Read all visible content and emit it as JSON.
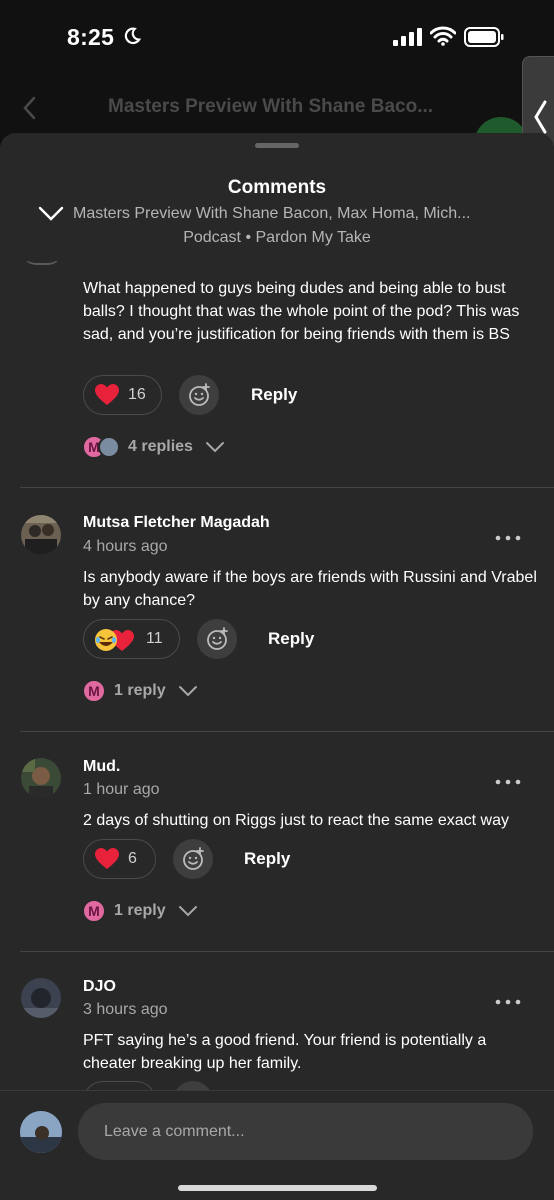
{
  "status_bar": {
    "time": "8:25"
  },
  "background": {
    "title": "Masters Preview With Shane Baco..."
  },
  "sheet": {
    "title": "Comments",
    "episode": "Masters Preview With Shane Bacon, Max Homa, Mich...",
    "podcast": "Podcast • Pardon My Take"
  },
  "comments": [
    {
      "text": "What happened to guys being dudes and being able to bust balls? I thought that was the whole point of the pod? This was sad, and you’re justification for being friends with them is BS",
      "reaction_count": "16",
      "reply_label": "Reply",
      "replies_label": "4 replies",
      "reply_avatar_letter": "M"
    },
    {
      "username": "Mutsa Fletcher Magadah",
      "time": "4 hours ago",
      "text": "Is anybody aware if the boys are friends with Russini and Vrabel by any chance?",
      "reaction_count": "11",
      "reply_label": "Reply",
      "replies_label": "1 reply",
      "reply_avatar_letter": "M"
    },
    {
      "username": "Mud.",
      "time": "1 hour ago",
      "text": "2 days of shutting on Riggs just to react the same exact way",
      "reaction_count": "6",
      "reply_label": "Reply",
      "replies_label": "1 reply",
      "reply_avatar_letter": "M"
    },
    {
      "username": "DJO",
      "time": "3 hours ago",
      "text": "PFT saying he’s a good friend. Your friend is potentially a cheater breaking up her family."
    }
  ],
  "input": {
    "placeholder": "Leave a comment..."
  },
  "colors": {
    "heart": "#e8223a",
    "reply_badge": "#e06aa0",
    "sheet_bg": "#282828"
  }
}
